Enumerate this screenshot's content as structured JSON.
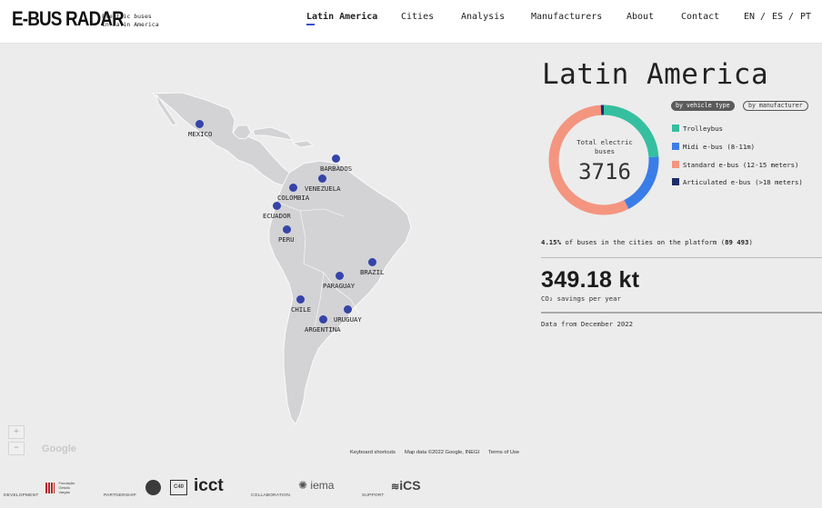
{
  "header": {
    "logo": "E-BUS RADAR",
    "tagline_line1": "Electric buses",
    "tagline_line2": "in Latin America",
    "nav": [
      "Latin America",
      "Cities",
      "Analysis",
      "Manufacturers",
      "About",
      "Contact"
    ],
    "lang_en": "EN",
    "lang_es": "ES",
    "lang_pt": "PT",
    "lang_sep": "/"
  },
  "map": {
    "cities": [
      {
        "name": "MEXICO"
      },
      {
        "name": "BARBADOS"
      },
      {
        "name": "VENEZUELA"
      },
      {
        "name": "COLOMBIA"
      },
      {
        "name": "ECUADOR"
      },
      {
        "name": "PERU"
      },
      {
        "name": "BRAZIL"
      },
      {
        "name": "PARAGUAY"
      },
      {
        "name": "CHILE"
      },
      {
        "name": "URUGUAY"
      },
      {
        "name": "ARGENTINA"
      }
    ],
    "zoom_in": "+",
    "zoom_out": "−",
    "google": "Google",
    "keyboard": "Keyboard shortcuts",
    "map_data": "Map data ©2022 Google, INEGI",
    "terms": "Terms of Use"
  },
  "panel": {
    "title": "Latin America",
    "toggle_vehicle": "by vehicle type",
    "toggle_manufacturer": "by manufacturer",
    "total_label": "Total electric buses",
    "total_value": "3716",
    "legend": [
      {
        "label": "Trolleybus",
        "color": "#35bfa0",
        "share": 0.24
      },
      {
        "label": "Midi e-bus (8-11m)",
        "color": "#3b7de8",
        "share": 0.185
      },
      {
        "label": "Standard e-bus (12-15 meters)",
        "color": "#f49580",
        "share": 0.565
      },
      {
        "label": "Articulated e-bus (>18 meters)",
        "color": "#1f2c66",
        "share": 0.01
      }
    ],
    "share_pct": "4.15%",
    "share_text": " of buses in the cities on the platform (",
    "share_total": "89 493",
    "share_close": ")",
    "savings_value": "349.18 kt",
    "savings_label": "CO₂ savings per year",
    "data_date": "Data from December 2022"
  },
  "footer": {
    "development": "DEVELOPMENT",
    "partnership": "PARTNERSHIP",
    "collaboration": "COLLABORATION",
    "support": "SUPPORT",
    "logo_icct": "icct",
    "logo_iema": "iema",
    "logo_ics": "iCS",
    "logo_c40": "C40",
    "logo_fgv": "Fundação Getulio Vargas"
  }
}
